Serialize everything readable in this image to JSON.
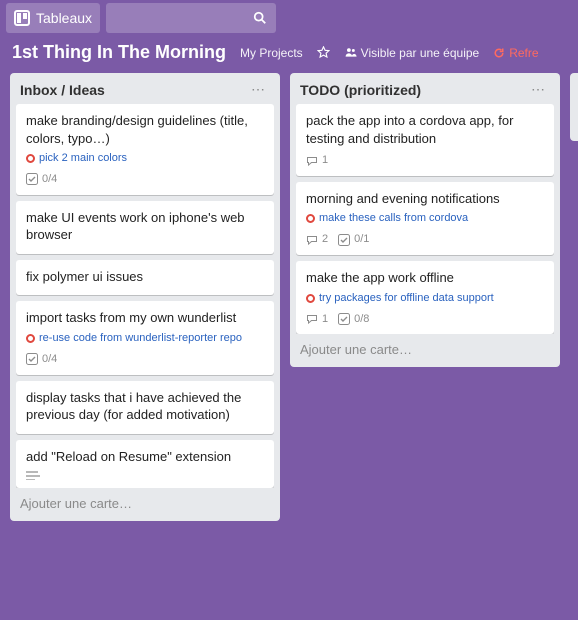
{
  "topbar": {
    "boards_label": "Tableaux"
  },
  "boardbar": {
    "title": "1st Thing In The Morning",
    "my_projects": "My Projects",
    "visibility": "Visible par une équipe",
    "refresh": "Refre"
  },
  "lists": [
    {
      "title": "Inbox / Ideas",
      "add_card_label": "Ajouter une carte…",
      "cards": [
        {
          "title": "make branding/design guidelines (title, colors, typo…)",
          "attachment": "pick 2 main colors",
          "checklist": "0/4"
        },
        {
          "title": "make UI events work on iphone's web browser"
        },
        {
          "title": "fix polymer ui issues"
        },
        {
          "title": "import tasks from my own wunderlist",
          "attachment": "re-use code from wunderlist-reporter repo",
          "checklist": "0/4"
        },
        {
          "title": "display tasks that i have achieved the previous day (for added motivation)"
        },
        {
          "title": "add \"Reload on Resume\" extension",
          "has_description": true
        }
      ]
    },
    {
      "title": "TODO (prioritized)",
      "add_card_label": "Ajouter une carte…",
      "cards": [
        {
          "title": "pack the app into a cordova app, for testing and distribution",
          "comments": "1"
        },
        {
          "title": "morning and evening notifications",
          "attachment": "make these calls from cordova",
          "comments": "2",
          "checklist": "0/1"
        },
        {
          "title": "make the app work offline",
          "attachment": "try packages for offline data support",
          "comments": "1",
          "checklist": "0/8"
        }
      ]
    }
  ]
}
